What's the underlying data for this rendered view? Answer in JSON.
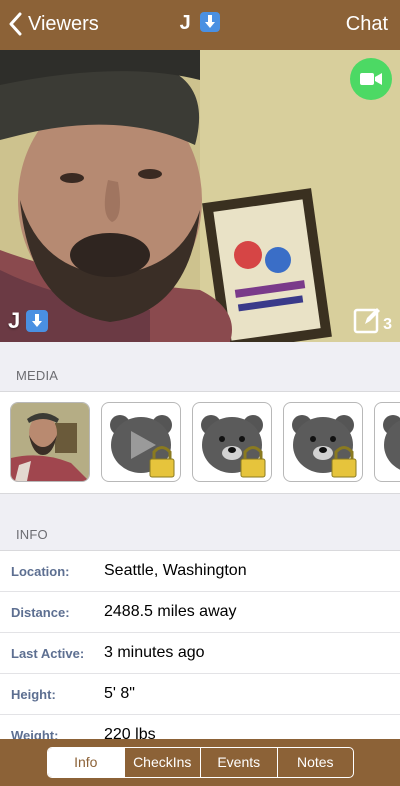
{
  "nav": {
    "back_label": "Viewers",
    "title": "J",
    "chat_label": "Chat"
  },
  "photo": {
    "name": "J",
    "edit_count": "3"
  },
  "media": {
    "header": "MEDIA"
  },
  "info": {
    "header": "INFO",
    "rows": [
      {
        "label": "Location:",
        "value": "Seattle, Washington"
      },
      {
        "label": "Distance:",
        "value": "2488.5 miles away"
      },
      {
        "label": "Last Active:",
        "value": "3 minutes ago"
      },
      {
        "label": "Height:",
        "value": "5' 8\""
      },
      {
        "label": "Weight:",
        "value": "220 lbs"
      }
    ]
  },
  "tabs": [
    {
      "label": "Info",
      "active": true
    },
    {
      "label": "CheckIns",
      "active": false
    },
    {
      "label": "Events",
      "active": false
    },
    {
      "label": "Notes",
      "active": false
    }
  ],
  "colors": {
    "brand_brown": "#8c6237",
    "video_green": "#4cd964",
    "download_blue": "#4a90e2",
    "label_blue": "#5d6f91"
  },
  "icons": [
    "chevron-left-icon",
    "download-icon",
    "video-camera-icon",
    "edit-icon",
    "bear-icon",
    "play-icon",
    "lock-icon"
  ]
}
